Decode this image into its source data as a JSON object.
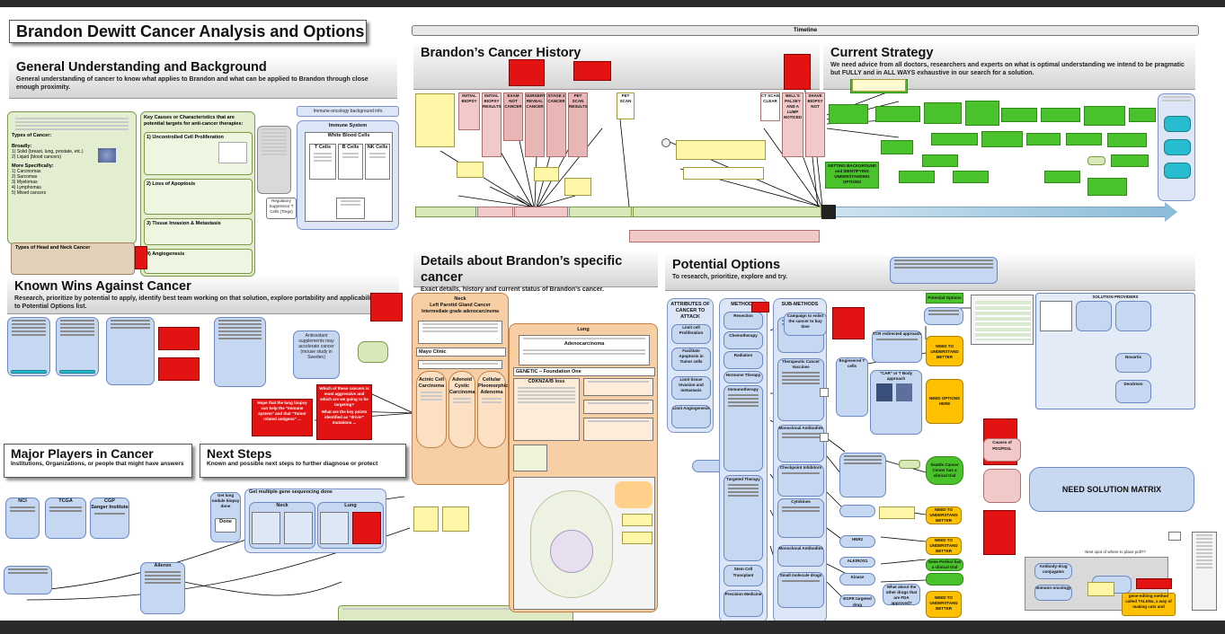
{
  "title": "Brandon Dewitt Cancer Analysis and Options",
  "sections": {
    "general": {
      "title": "General Understanding and Background",
      "subtitle": "General understanding of cancer to know what applies to Brandon and what can be applied to Brandon through close enough proximity."
    },
    "known_wins": {
      "title": "Known Wins Against Cancer",
      "subtitle": "Research, prioritize by potential to apply, identify best team working on that solution, explore portability and applicability, and to Potential Options list."
    },
    "major_players": {
      "title": "Major Players in Cancer",
      "subtitle": "Institutions, Organizations, or people that might have answers"
    },
    "next_steps": {
      "title": "Next Steps",
      "subtitle": "Known and possible next steps to further diagnose or protect"
    },
    "timeline": {
      "label": "Timeline"
    },
    "history": {
      "title": "Brandon’s Cancer History"
    },
    "strategy": {
      "title": "Current Strategy",
      "subtitle": "We need advice from all doctors, researchers and experts on what is optimal understanding we intend to be pragmatic but FULLY and in ALL WAYS exhaustive in our search for a solution."
    },
    "details": {
      "title": "Details about Brandon’s specific cancer",
      "subtitle": "Exact details, history and current status of Brandon’s cancer."
    },
    "options": {
      "title": "Potential Options",
      "subtitle": "To research, prioritize, explore and try."
    }
  },
  "background": {
    "types_heading": "Types of Cancer:",
    "broadly": "Broadly:",
    "broad_items": [
      "1) Solid (breast, lung, prostate, etc.)",
      "2) Liquid (blood cancers)"
    ],
    "more_specifically": "More Specifically:",
    "specific_items": [
      "1) Carcinomas",
      "2) Sarcomas",
      "3) Myelomas",
      "4) Lymphomas",
      "5) Mixed cancers"
    ],
    "key_causes": "Key Causes or Characteristics that are potential targets for anti-cancer therapies:",
    "causes": [
      "1) Uncontrolled Cell Proliferation",
      "2) Loss of Apoptosis",
      "3) Tissue Invasion & Metastasis",
      "4) Angiogenesis"
    ],
    "head_neck": "Types of Head and Neck Cancer",
    "immune_bg": "Immune-oncology background info",
    "immune_system": "Immune System",
    "white_blood_cells": "White Blood Cells",
    "cells": [
      "T Cells",
      "B Cells",
      "NK Cells"
    ],
    "regulatory": "Regulatory Suppressor T Cells (Tregs)"
  },
  "history_events": [
    "INITIAL BIOPSY",
    "INITIAL BIOPSY RESULTS",
    "EXAM NOT CANCER",
    "SURGERY REVEAL CANCER",
    "STAGE 3 CANCER",
    "PET SCAN RESULTS",
    "PET SCAN",
    "CT SCAN CLEAR",
    "BELL'S PALSEY AND A LUMP NOTICED",
    "SHAVE BIOPSY NOT"
  ],
  "strategy_box": "GETTING BACKGROUND and IDENTIFYING UNDERSTANDING OPTIONS",
  "details": {
    "neck": "Neck",
    "neck_diag": "Left Parotid Gland Cancer",
    "neck_grade": "Intermediate grade adenocarcinoma",
    "mayo": "Mayo Clinic",
    "subtypes": [
      "Acinic Cell Carcinoma",
      "Adenoid Cystic Carcinoma",
      "Cellular Pleomorphic Adenoma"
    ],
    "lung": "Lung",
    "lung_diag": "Adenocarcinoma",
    "genetic": "GENETIC – Foundation One",
    "cdkn2ab": "CDKN2A/B loss"
  },
  "options": {
    "attributes": "ATTRIBUTES OF CANCER TO ATTACK",
    "attr_items": [
      "Limit cell Proliferation",
      "Facilitate Apoptosis in Tumor cells",
      "Limit tissue Invasion and metastasis",
      "Limit Angiogenesis"
    ],
    "methods": "METHODS",
    "method_items": [
      "Resection",
      "Chemotherapy",
      "Radiation",
      "Hormone Therapy",
      "Immunotherapy",
      "Targeted Therapy",
      "Stem Cell Transplant",
      "Precision Medicine"
    ],
    "sub_methods": "SUB-METHODS",
    "sub_items": [
      "Therapeutic Cancer Vaccines",
      "Monoclonal Antibodies",
      "Checkpoint Inhibitors",
      "Cytokines",
      "Monoclonal Antibodies",
      "Small molecule drugs"
    ],
    "car_t": "\"CAR\" or T Body approach",
    "tcr": "TCR redirected approach",
    "engineered": "Engineered T cells",
    "campaign": "Campaign to enlist the cancer to buy time",
    "need_understand": "NEED TO UNDERSTAND BETTER",
    "need_options": "NEED OPTIONS HERE",
    "potential_options": "Potential Options",
    "seattle": "Seattle Cancer Center has a clinical trial",
    "solution_matrix": "NEED SOLUTION MATRIX",
    "solution_providers": "SOLUTION PROVIDERS",
    "novartis": "Novartis",
    "dendreon": "Dendreon",
    "causes_pd1": "Causes of PD1/PD1L",
    "alk": "ALK/ROS1",
    "kinase": "Kinase",
    "egfr": "EGFR targeted drug",
    "her2": "HER2",
    "crs": "Gene Perfect has a clinical trial",
    "what_about": "What about the other drugs that are FDA approved?",
    "antibody_drug": "Antibody-drug conjugates",
    "immuno_oncology": "Immuno-oncology",
    "gene_editing": "gene-editing method called TALENs, a way of making cuts and",
    "next_place": "Next spot of where to place poll??"
  },
  "players": [
    "NCI",
    "TCGA",
    "CGP",
    "Sanger Institute",
    "Aileron"
  ],
  "next_steps": {
    "get_lung": "Get lung nodule biopsy done",
    "done": "Done",
    "genetic_seq": "Get multiple gene sequencing done",
    "neck": "Neck",
    "lung": "Lung"
  },
  "known_wins_misc": [
    "Antioxidant supplements may accelerate cancer (mouse study in Sweden)"
  ],
  "red_notes": [
    "Hope that the lung biopsy can help the \"Immune system\" and that \"Tumor related antigens\" ...",
    "Which of these cancers is most aggressive and which are we going to be targeting?",
    "What are the key points identified as \"driver\" mutations ..."
  ]
}
